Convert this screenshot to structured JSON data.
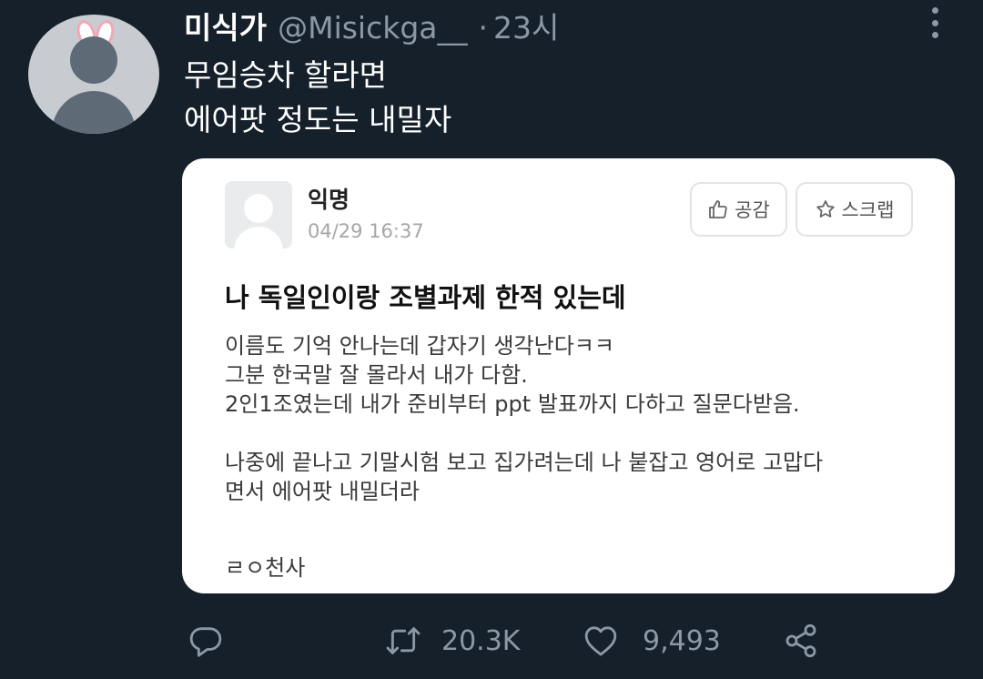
{
  "tweet": {
    "display_name": "미식가",
    "handle": "@Misickga__",
    "separator": "·",
    "time": "23시",
    "text_lines": [
      "무임승차 할라면",
      "에어팟 정도는 내밀자"
    ]
  },
  "card": {
    "author": "익명",
    "date": "04/29 16:37",
    "like_label": "공감",
    "scrap_label": "스크랩",
    "title": "나 독일인이랑 조별과제 한적 있는데",
    "body_lines": [
      "이름도 기억 안나는데 갑자기 생각난다ㅋㅋ",
      "그분 한국말 잘 몰라서 내가 다함.",
      "2인1조였는데 내가 준비부터 ppt 발표까지 다하고 질문다받음.",
      "",
      "나중에 끝나고 기말시험 보고 집가려는데 나 붙잡고 영어로 고맙다",
      "면서 에어팟 내밀더라"
    ],
    "sign": "ㄹㅇ천사"
  },
  "actions": {
    "retweet_count": "20.3K",
    "like_count": "9,493"
  },
  "icons": [
    "more-icon",
    "thumbs-up-icon",
    "star-icon",
    "reply-icon",
    "retweet-icon",
    "heart-icon",
    "share-icon"
  ],
  "colors": {
    "background": "#15202b",
    "secondary_text": "#8b98a5",
    "primary_text": "#ffffff"
  }
}
